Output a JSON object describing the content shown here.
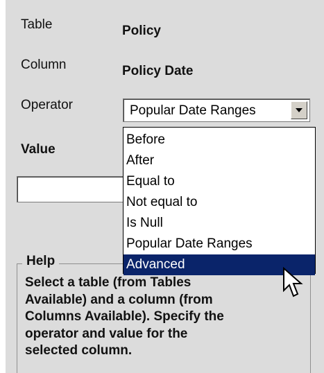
{
  "form": {
    "table_label": "Table",
    "table_value": "Policy",
    "column_label": "Column",
    "column_value": "Policy Date",
    "operator_label": "Operator",
    "operator_selected": "Popular Date Ranges",
    "value_label": "Value",
    "value_input": ""
  },
  "dropdown": {
    "items": [
      "Before",
      "After",
      "Equal to",
      "Not equal to",
      "Is Null",
      "Popular Date Ranges",
      "Advanced"
    ],
    "highlighted": "Advanced"
  },
  "help": {
    "title": "Help",
    "lines": [
      "Select a table (from Tables",
      "Available) and a column (from",
      "Columns Available). Specify the",
      "operator and value for the",
      "selected column."
    ]
  },
  "colors": {
    "panel_background": "#dcdcdc",
    "selection_background": "#0a246a",
    "selection_text": "#ffffff"
  },
  "icons": {
    "combo_arrow": "chevron-down-icon",
    "pointer": "mouse-pointer-icon"
  }
}
